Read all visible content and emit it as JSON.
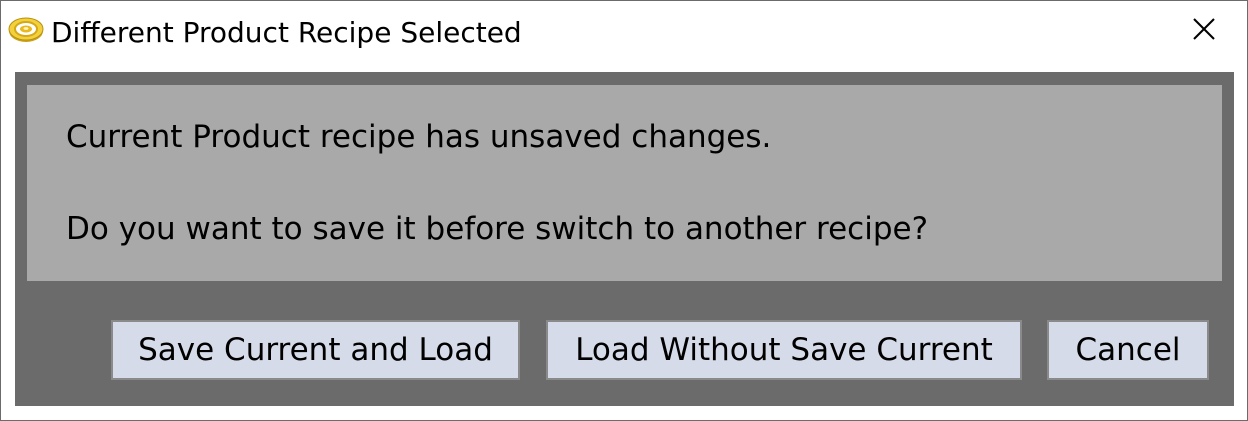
{
  "window": {
    "title": "Different Product Recipe Selected",
    "app_icon": "target-coin-icon",
    "close_icon": "close-icon"
  },
  "message": {
    "line1": "Current Product recipe has unsaved changes.",
    "line2": "Do you want to save it before switch to another recipe?"
  },
  "buttons": {
    "save_and_load": "Save Current and Load",
    "load_without_save": "Load Without Save Current",
    "cancel": "Cancel"
  },
  "colors": {
    "dialog_background": "#6b6b6b",
    "message_background": "#a9a9a9",
    "button_background": "#d6dbe9"
  }
}
